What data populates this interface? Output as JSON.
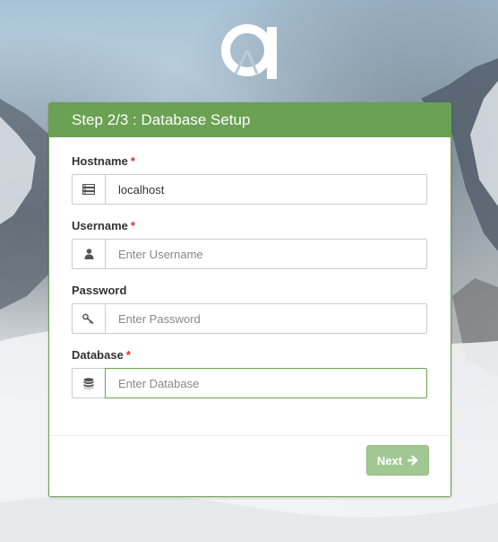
{
  "header": {
    "title": "Step 2/3 : Database Setup"
  },
  "fields": [
    {
      "label": "Hostname",
      "required": "*",
      "value": "localhost",
      "placeholder": "",
      "icon": "server-icon"
    },
    {
      "label": "Username",
      "required": "*",
      "value": "",
      "placeholder": "Enter Username",
      "icon": "user-icon"
    },
    {
      "label": "Password",
      "required": "",
      "value": "",
      "placeholder": "Enter Password",
      "icon": "key-icon"
    },
    {
      "label": "Database",
      "required": "*",
      "value": "",
      "placeholder": "Enter Database",
      "icon": "database-icon"
    }
  ],
  "footer": {
    "next_label": "Next",
    "next_icon": "arrow-right-icon"
  },
  "colors": {
    "header_bg": "#6aa152",
    "button_bg": "#a1c893",
    "required": "#d9302b",
    "focus_border": "#6aa152"
  }
}
